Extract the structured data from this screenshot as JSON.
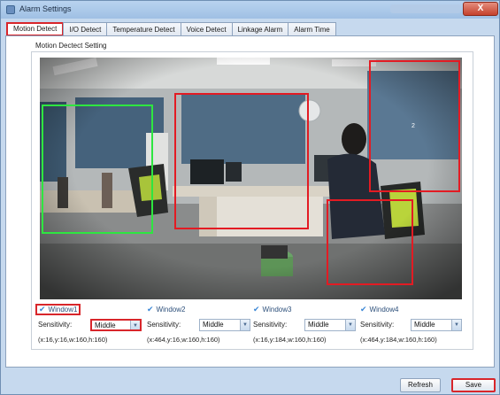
{
  "window": {
    "title": "Alarm Settings",
    "close_label": "X"
  },
  "tabs": [
    {
      "label": "Motion Detect",
      "active": true
    },
    {
      "label": "I/O Detect",
      "active": false
    },
    {
      "label": "Temperature Detect",
      "active": false
    },
    {
      "label": "Voice Detect",
      "active": false
    },
    {
      "label": "Linkage Alarm",
      "active": false
    },
    {
      "label": "Alarm Time",
      "active": false
    }
  ],
  "group": {
    "title": "Motion Dectect Setting"
  },
  "video": {
    "window2_number": "2"
  },
  "windows": [
    {
      "label": "Window1",
      "checked": true,
      "sensitivity_label": "Sensitivity:",
      "sensitivity": "Middle",
      "coords": "(x:16,y:16,w:160,h:160)"
    },
    {
      "label": "Window2",
      "checked": true,
      "sensitivity_label": "Sensitivity:",
      "sensitivity": "Middle",
      "coords": "(x:464,y:16,w:160,h:160)"
    },
    {
      "label": "Window3",
      "checked": true,
      "sensitivity_label": "Sensitivity:",
      "sensitivity": "Middle",
      "coords": "(x:16,y:184,w:160,h:160)"
    },
    {
      "label": "Window4",
      "checked": true,
      "sensitivity_label": "Sensitivity:",
      "sensitivity": "Middle",
      "coords": "(x:464,y:184,w:160,h:160)"
    }
  ],
  "buttons": {
    "refresh": "Refresh",
    "save": "Save"
  },
  "colors": {
    "highlight": "#d8262b",
    "detect_red": "#e31b23",
    "detect_green": "#2ee640",
    "check_blue": "#3b87d6"
  }
}
